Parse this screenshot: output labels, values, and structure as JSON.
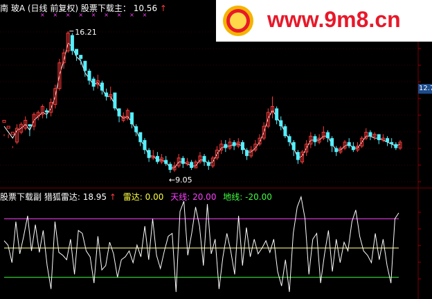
{
  "main_header": {
    "stock": "南 玻A",
    "period": "(日线 前复权)",
    "indicator_label": "股票下载主：",
    "indicator_value": "10.56",
    "arrow": "↑"
  },
  "indicator_header": {
    "panel_label": "股票下载副",
    "name_label": "猎狐雷达:",
    "name_value": "18.95",
    "arrow": "↑",
    "radar_label": "雷达:",
    "radar_value": "0.00",
    "sky_label": "天线:",
    "sky_value": "20.00",
    "ground_label": "地线:",
    "ground_value": "-20.00"
  },
  "watermark": {
    "text": "www.9m8.cn"
  },
  "right_tag": "12.7",
  "annotations": {
    "high_label": "16.21",
    "low_label": "←9.05"
  },
  "colors": {
    "up": "#ff3b3b",
    "down": "#54f0ff",
    "price_line": "#ffffff",
    "marker": "#ff40ff",
    "radar": "#ffffff",
    "sky": "#ff40ff",
    "ground": "#40ff40",
    "zero": "#ffff80",
    "yellow": "#ffff40",
    "header_white": "#ffffff",
    "header_yellow": "#ffff40"
  },
  "chart_data": [
    {
      "type": "candlestick",
      "title": "南 玻A (日线 前复权) 股票下载主",
      "ylim": [
        8.6,
        17.0
      ],
      "markers_top": 9,
      "candles": [
        [
          11.6,
          11.7,
          11.0,
          10.9,
          11.4
        ],
        [
          11.3,
          11.4,
          11.0,
          10.8,
          11.1
        ],
        [
          11.0,
          11.1,
          10.4,
          10.3,
          10.8
        ],
        [
          10.6,
          11.3,
          10.5,
          11.5,
          11.2
        ],
        [
          11.1,
          11.5,
          11.0,
          11.6,
          11.3
        ],
        [
          11.3,
          11.7,
          11.2,
          11.9,
          11.5
        ],
        [
          11.5,
          11.4,
          10.9,
          11.5,
          11.2
        ],
        [
          11.4,
          12.0,
          11.2,
          12.1,
          11.7
        ],
        [
          11.9,
          12.1,
          11.7,
          12.2,
          11.9
        ],
        [
          12.0,
          12.4,
          11.8,
          12.5,
          12.1
        ],
        [
          12.2,
          12.1,
          11.8,
          12.3,
          12.0
        ],
        [
          12.1,
          12.6,
          11.9,
          12.8,
          12.3
        ],
        [
          12.5,
          13.3,
          12.3,
          13.5,
          12.9
        ],
        [
          13.3,
          14.6,
          13.2,
          14.8,
          14.0
        ],
        [
          14.6,
          15.1,
          14.3,
          15.3,
          14.7
        ],
        [
          15.2,
          16.1,
          15.1,
          16.2,
          15.6
        ],
        [
          16.0,
          15.2,
          15.0,
          16.1,
          15.4
        ],
        [
          15.3,
          15.0,
          14.7,
          15.3,
          14.9
        ],
        [
          15.0,
          14.8,
          14.5,
          15.0,
          14.7
        ],
        [
          14.7,
          14.2,
          13.9,
          14.7,
          14.1
        ],
        [
          14.2,
          13.7,
          13.5,
          14.3,
          13.8
        ],
        [
          13.8,
          13.4,
          13.2,
          13.9,
          13.5
        ],
        [
          13.5,
          13.7,
          13.3,
          14.0,
          13.6
        ],
        [
          13.6,
          13.2,
          13.0,
          13.7,
          13.3
        ],
        [
          13.1,
          12.9,
          12.7,
          13.3,
          12.9
        ],
        [
          12.9,
          13.0,
          12.7,
          13.4,
          12.9
        ],
        [
          13.1,
          12.3,
          12.2,
          13.1,
          12.5
        ],
        [
          12.3,
          11.9,
          11.6,
          12.3,
          12.0
        ],
        [
          11.7,
          11.9,
          11.6,
          12.1,
          11.8
        ],
        [
          11.8,
          12.2,
          11.7,
          12.3,
          11.9
        ],
        [
          12.1,
          11.5,
          11.3,
          12.1,
          11.6
        ],
        [
          11.4,
          11.1,
          10.9,
          11.5,
          11.2
        ],
        [
          11.1,
          10.6,
          10.4,
          11.1,
          10.7
        ],
        [
          10.7,
          10.2,
          10.0,
          10.8,
          10.4
        ],
        [
          10.2,
          9.8,
          9.6,
          10.3,
          9.9
        ],
        [
          9.8,
          9.9,
          9.7,
          10.2,
          9.9
        ],
        [
          9.9,
          9.6,
          9.5,
          10.1,
          9.7
        ],
        [
          9.6,
          9.8,
          9.5,
          10.0,
          9.7
        ],
        [
          9.7,
          9.5,
          9.4,
          9.9,
          9.6
        ],
        [
          9.5,
          9.2,
          9.05,
          9.6,
          9.3
        ],
        [
          9.2,
          9.4,
          9.1,
          9.6,
          9.3
        ],
        [
          9.4,
          9.8,
          9.3,
          10.0,
          9.6
        ],
        [
          9.8,
          9.5,
          9.3,
          9.9,
          9.6
        ],
        [
          9.5,
          9.6,
          9.4,
          9.8,
          9.5
        ],
        [
          9.6,
          9.3,
          9.2,
          9.7,
          9.4
        ],
        [
          9.3,
          9.6,
          9.3,
          9.7,
          9.4
        ],
        [
          9.6,
          9.9,
          9.5,
          10.1,
          9.7
        ],
        [
          9.9,
          9.6,
          9.4,
          10.0,
          9.7
        ],
        [
          9.6,
          9.4,
          9.2,
          9.7,
          9.5
        ],
        [
          9.4,
          9.8,
          9.3,
          9.9,
          9.6
        ],
        [
          9.8,
          10.2,
          9.7,
          10.4,
          10.0
        ],
        [
          10.2,
          10.5,
          10.0,
          10.7,
          10.3
        ],
        [
          10.5,
          10.3,
          10.1,
          10.7,
          10.4
        ],
        [
          10.3,
          10.6,
          10.2,
          10.8,
          10.4
        ],
        [
          10.6,
          10.4,
          10.2,
          10.7,
          10.5
        ],
        [
          10.4,
          10.6,
          10.3,
          10.8,
          10.5
        ],
        [
          10.6,
          10.2,
          10.0,
          10.7,
          10.4
        ],
        [
          10.2,
          9.9,
          9.7,
          10.3,
          10.1
        ],
        [
          9.9,
          10.2,
          9.8,
          10.4,
          10.1
        ],
        [
          10.2,
          10.5,
          10.1,
          10.7,
          10.3
        ],
        [
          10.5,
          10.8,
          10.4,
          11.0,
          10.6
        ],
        [
          10.8,
          11.4,
          10.7,
          11.6,
          11.1
        ],
        [
          11.4,
          12.1,
          11.3,
          12.3,
          11.8
        ],
        [
          12.1,
          12.4,
          11.8,
          12.9,
          12.2
        ],
        [
          12.3,
          11.7,
          11.5,
          12.4,
          11.9
        ],
        [
          11.7,
          11.4,
          11.2,
          11.9,
          11.5
        ],
        [
          11.4,
          10.9,
          10.8,
          11.5,
          11.1
        ],
        [
          10.9,
          10.6,
          10.4,
          11.0,
          10.7
        ],
        [
          10.6,
          10.2,
          9.9,
          10.7,
          10.3
        ],
        [
          10.1,
          9.7,
          9.5,
          10.2,
          9.8
        ],
        [
          9.6,
          10.1,
          9.5,
          10.2,
          9.9
        ],
        [
          10.1,
          10.5,
          9.9,
          10.7,
          10.3
        ],
        [
          10.5,
          10.9,
          10.3,
          11.1,
          10.7
        ],
        [
          10.9,
          10.6,
          10.4,
          11.0,
          10.7
        ],
        [
          10.6,
          10.8,
          10.5,
          11.0,
          10.7
        ],
        [
          10.8,
          11.1,
          10.7,
          11.4,
          10.9
        ],
        [
          11.1,
          10.8,
          10.6,
          11.2,
          10.9
        ],
        [
          10.8,
          10.4,
          10.1,
          10.9,
          10.5
        ],
        [
          10.3,
          10.1,
          9.9,
          10.4,
          10.2
        ],
        [
          10.1,
          10.3,
          10.0,
          10.4,
          10.2
        ],
        [
          10.3,
          10.6,
          10.2,
          10.7,
          10.4
        ],
        [
          10.6,
          10.4,
          10.3,
          10.8,
          10.5
        ],
        [
          10.4,
          10.2,
          10.1,
          10.6,
          10.3
        ],
        [
          10.2,
          10.4,
          10.1,
          10.6,
          10.3
        ],
        [
          10.4,
          10.8,
          10.3,
          10.9,
          10.6
        ],
        [
          10.8,
          11.1,
          10.7,
          11.3,
          10.9
        ],
        [
          11.1,
          10.9,
          10.7,
          11.2,
          10.9
        ],
        [
          10.9,
          11.0,
          10.7,
          11.1,
          10.8
        ],
        [
          11.0,
          10.7,
          10.5,
          11.0,
          10.8
        ],
        [
          10.7,
          10.8,
          10.6,
          11.0,
          10.7
        ],
        [
          10.8,
          10.6,
          10.4,
          10.9,
          10.6
        ],
        [
          10.6,
          10.5,
          10.3,
          10.8,
          10.5
        ],
        [
          10.5,
          10.3,
          10.2,
          10.6,
          10.4
        ],
        [
          10.3,
          10.6,
          10.2,
          10.7,
          10.5
        ]
      ]
    },
    {
      "type": "line",
      "title": "股票下载副 猎狐雷达",
      "ylim": [
        -32,
        32
      ],
      "reference_lines": {
        "sky": 20,
        "zero": 0,
        "ground": -20
      },
      "series": [
        {
          "name": "猎狐雷达",
          "values": [
            5,
            2,
            -10,
            18,
            -4,
            8,
            22,
            -2,
            16,
            -3,
            12,
            -12,
            -28,
            18,
            -3,
            -5,
            -8,
            6,
            -18,
            12,
            10,
            -2,
            -6,
            -24,
            8,
            -15,
            -12,
            4,
            -4,
            -20,
            -8,
            -6,
            -2,
            -10,
            2,
            -6,
            15,
            -8,
            20,
            -5,
            -14,
            -2,
            8,
            10,
            -30,
            25,
            32,
            -5,
            10,
            28,
            15,
            -12,
            30,
            -4,
            6,
            -28,
            -6,
            10,
            -2,
            -18,
            22,
            -12,
            14,
            -6,
            6,
            -4,
            0,
            5,
            -3,
            6,
            -16,
            -26,
            -8,
            -30,
            10,
            28,
            35,
            20,
            -18,
            6,
            10,
            -24,
            -4,
            12,
            -16,
            6,
            -10,
            4,
            -2,
            18,
            26,
            8,
            -2,
            -5,
            -10,
            10,
            -8,
            6,
            -12,
            -24,
            20,
            24
          ]
        }
      ]
    }
  ]
}
